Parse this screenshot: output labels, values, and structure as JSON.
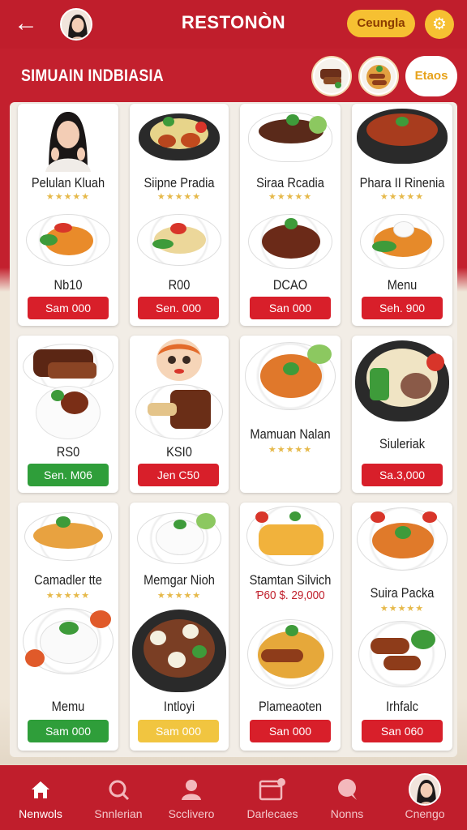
{
  "header": {
    "back_icon": "back-arrow-icon",
    "title": "RESTONÒN",
    "pill_label": "Ceungla",
    "settings_icon": "gear-icon"
  },
  "subheader": {
    "title": "SIMUAIN INDBIASIA",
    "pill_label": "Etaos"
  },
  "colors": {
    "brand_red": "#c01e2c",
    "button_red": "#d81f2a",
    "button_green": "#2f9e3a",
    "button_yellow": "#f1c540",
    "star_gold": "#e6b94a"
  },
  "cards": [
    {
      "top_name": "Pelulan Kluah",
      "bottom_name": "Nb10",
      "price": "Sam 000",
      "price_color": "red"
    },
    {
      "top_name": "Siipne Pradia",
      "bottom_name": "R00",
      "price": "Sen. 000",
      "price_color": "red"
    },
    {
      "top_name": "Siraa Rcadia",
      "bottom_name": "DCAO",
      "price": "San 000",
      "price_color": "red"
    },
    {
      "top_name": "Phara II Rinenia",
      "bottom_name": "Menu",
      "price": "Seh. 900",
      "price_color": "red"
    },
    {
      "name": "RS0",
      "price": "Sen. M06",
      "price_color": "green"
    },
    {
      "name": "KSI0",
      "price": "Jen C50",
      "price_color": "red"
    },
    {
      "name": "Mamuan Nalan",
      "price": "",
      "price_color": "none"
    },
    {
      "name": "Siuleriak",
      "price": "Sa.3,000",
      "price_color": "red"
    },
    {
      "top_name": "Camadler tte",
      "bottom_name": "Memu",
      "price": "Sam 000",
      "price_color": "green"
    },
    {
      "top_name": "Memgar Nioh",
      "bottom_name": "Intloyi",
      "price": "Sam 000",
      "price_color": "yellow"
    },
    {
      "top_name": "Stamtan Silvich",
      "note": "Ƥ60  $. 29,000",
      "bottom_name": "Plameaoten",
      "price": "San 000",
      "price_color": "red"
    },
    {
      "top_name": "Suira Packa",
      "bottom_name": "Irhfalc",
      "price": "San 060",
      "price_color": "red"
    }
  ],
  "bottom_nav": [
    {
      "label": "Nenwols",
      "icon": "home-icon",
      "active": true
    },
    {
      "label": "Snnlerian",
      "icon": "search-icon",
      "active": false
    },
    {
      "label": "Scclivero",
      "icon": "user-icon",
      "active": false
    },
    {
      "label": "Darlecaes",
      "icon": "calendar-icon",
      "active": false
    },
    {
      "label": "Nonns",
      "icon": "chat-icon",
      "active": false
    },
    {
      "label": "Cnengo",
      "icon": "profile-avatar",
      "active": false
    }
  ]
}
